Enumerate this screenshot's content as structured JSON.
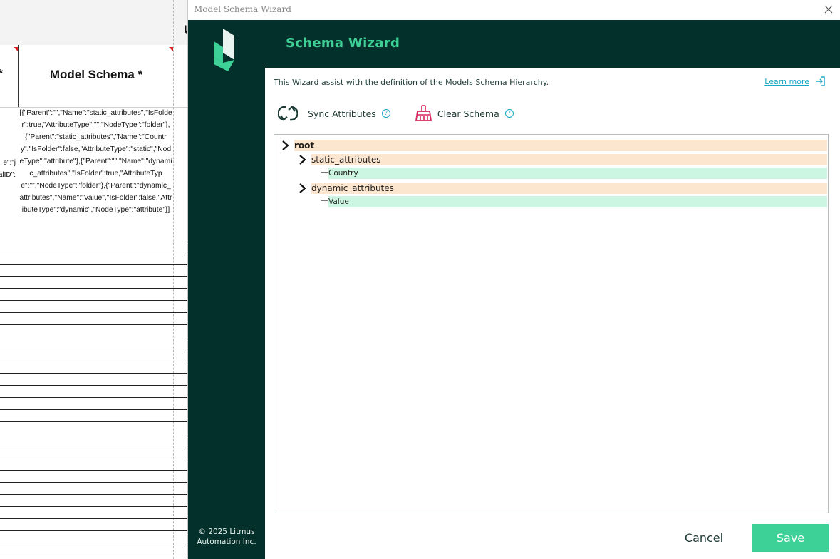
{
  "sheet": {
    "header_col_a": "*",
    "header_col_b": "Model Schema *",
    "header_col_c": "U",
    "left_fragments": [
      "e\":\"j",
      "alID\":"
    ],
    "model_schema_cell": "[{\"Parent\":\"\",\"Name\":\"static_attributes\",\"IsFolder\":true,\"AttributeType\":\"\",\"NodeType\":\"folder\"},{\"Parent\":\"static_attributes\",\"Name\":\"Country\",\"IsFolder\":false,\"AttributeType\":\"static\",\"NodeType\":\"attribute\"},{\"Parent\":\"\",\"Name\":\"dynamic_attributes\",\"IsFolder\":true,\"AttributeType\":\"\",\"NodeType\":\"folder\"},{\"Parent\":\"dynamic_attributes\",\"Name\":\"Value\",\"IsFolder\":false,\"AttributeType\":\"dynamic\",\"NodeType\":\"attribute\"}]"
  },
  "dialog": {
    "window_title": "Model Schema Wizard",
    "close_icon": "close-icon",
    "banner_title": "Schema Wizard",
    "intro_text": "This Wizard assist with the definition of the Models Schema Hierarchy.",
    "learn_more": "Learn more",
    "toolbar": {
      "sync_label": "Sync Attributes",
      "clear_label": "Clear Schema"
    },
    "tree": {
      "root": "root",
      "folders": [
        {
          "name": "static_attributes",
          "children": [
            "Country"
          ]
        },
        {
          "name": "dynamic_attributes",
          "children": [
            "Value"
          ]
        }
      ]
    },
    "copyright_line1": "© 2025 Litmus",
    "copyright_line2": "Automation Inc.",
    "cancel_label": "Cancel",
    "save_label": "Save",
    "colors": {
      "dark": "#04302b",
      "accent": "#3ed197",
      "folder_bg": "#fde6d0",
      "attribute_bg": "#cdf6e2",
      "link": "#1aa6c8"
    }
  }
}
